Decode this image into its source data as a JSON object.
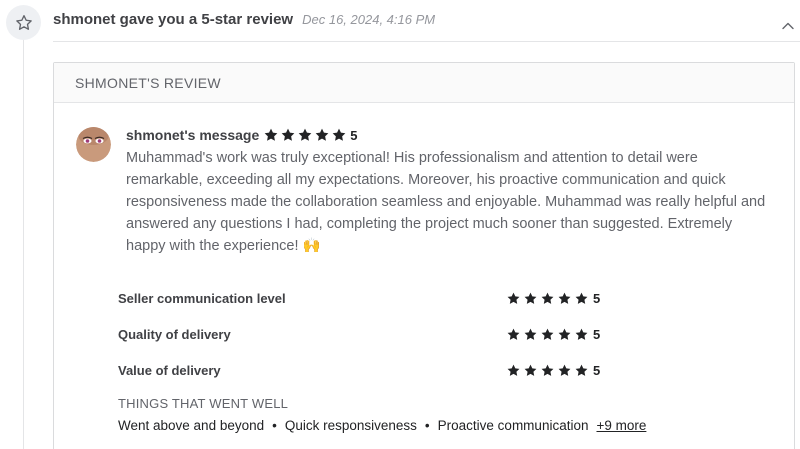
{
  "event": {
    "icon": "star-outline-icon",
    "title": "shmonet gave you a 5-star review",
    "timestamp": "Dec 16, 2024, 4:16 PM",
    "collapse_icon": "chevron-up-icon"
  },
  "review": {
    "heading": "SHMONET'S REVIEW",
    "message_author": "shmonet's message",
    "overall_score": "5",
    "message": "Muhammad's work was truly exceptional! His professionalism and attention to detail were remarkable, exceeding all my expectations. Moreover, his proactive communication and quick responsiveness made the collaboration seamless and enjoyable. Muhammad was really helpful and answered any questions I had, completing the project much sooner than suggested. Extremely happy with the experience! 🙌",
    "ratings": [
      {
        "label": "Seller communication level",
        "score": "5"
      },
      {
        "label": "Quality of delivery",
        "score": "5"
      },
      {
        "label": "Value of delivery",
        "score": "5"
      }
    ],
    "went_well": {
      "title": "THINGS THAT WENT WELL",
      "tags": [
        "Went above and beyond",
        "Quick responsiveness",
        "Proactive communication"
      ],
      "separator": "•",
      "more": "+9 more"
    }
  },
  "colors": {
    "star_fill": "#222325",
    "text_primary": "#404145",
    "text_muted": "#95979d"
  }
}
